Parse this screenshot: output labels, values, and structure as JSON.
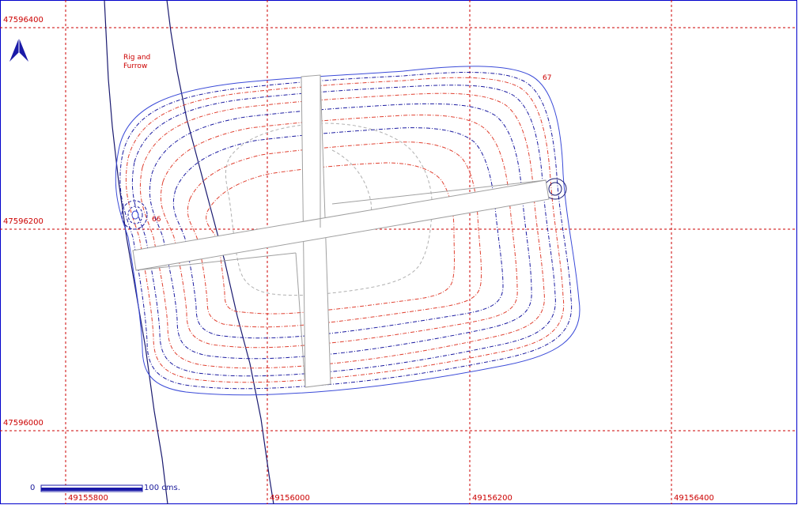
{
  "grid": {
    "northings": [
      "47596400",
      "47596200",
      "47596000"
    ],
    "eastings": [
      "49155800",
      "49156000",
      "49156200",
      "49156400"
    ]
  },
  "features": {
    "rig_and_furrow": "Rig and\nFurrow",
    "point_66": "66",
    "point_67": "67"
  },
  "scale_bar": {
    "start_label": "0",
    "end_label": "100 cms."
  },
  "north_arrow": {
    "icon": "north-arrow-icon"
  },
  "colors": {
    "grid": "#cc0000",
    "contour_blue": "#1a1aa0",
    "contour_red": "#e04030",
    "outline": "#3b4bd8",
    "trench": "#a0a0a0"
  }
}
